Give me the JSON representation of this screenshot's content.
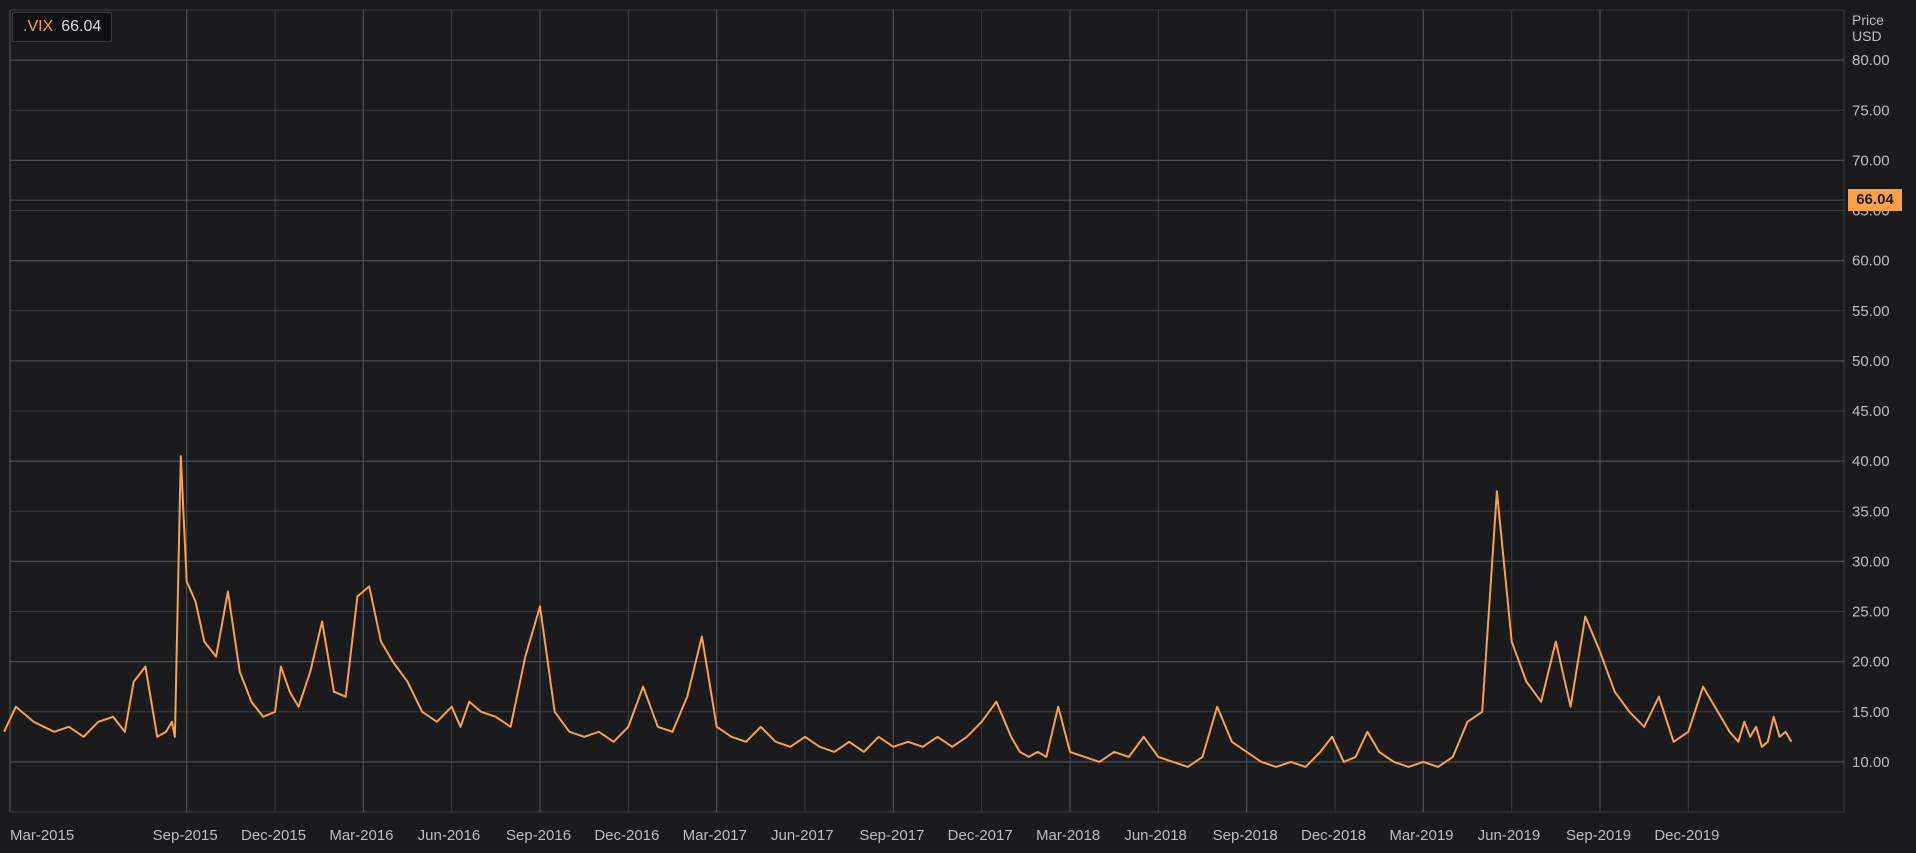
{
  "legend": {
    "ticker": ".VIX",
    "value": "66.04"
  },
  "axis_title": {
    "line1": "Price",
    "line2": "USD"
  },
  "last_price_badge": "66.04",
  "colors": {
    "series": "#f7a14a",
    "background": "#1b1b1d",
    "grid": "#3a3b3f"
  },
  "chart_data": {
    "type": "line",
    "title": "",
    "ylabel": "Price USD",
    "ylim": [
      5,
      85
    ],
    "y_ticks": [
      "10.00",
      "15.00",
      "20.00",
      "25.00",
      "30.00",
      "35.00",
      "40.00",
      "45.00",
      "50.00",
      "55.00",
      "60.00",
      "65.00",
      "70.00",
      "75.00",
      "80.00"
    ],
    "x_tick_labels": [
      "Mar-2015",
      "Sep-2015",
      "Dec-2015",
      "Mar-2016",
      "Jun-2016",
      "Sep-2016",
      "Dec-2016",
      "Mar-2017",
      "Jun-2017",
      "Sep-2017",
      "Dec-2017",
      "Mar-2018",
      "Jun-2018",
      "Sep-2018",
      "Dec-2018",
      "Mar-2019",
      "Jun-2019",
      "Sep-2019",
      "Dec-2019"
    ],
    "grid": true,
    "series": [
      {
        "name": ".VIX",
        "x_months_from_2015_03": [
          -0.2,
          0.2,
          0.8,
          1.5,
          2.0,
          2.5,
          3.0,
          3.5,
          3.9,
          4.2,
          4.6,
          5.0,
          5.3,
          5.5,
          5.6,
          5.8,
          6.0,
          6.3,
          6.6,
          7.0,
          7.4,
          7.8,
          8.2,
          8.6,
          9.0,
          9.2,
          9.5,
          9.8,
          10.2,
          10.6,
          11.0,
          11.4,
          11.8,
          12.2,
          12.6,
          13.0,
          13.5,
          14.0,
          14.5,
          15.0,
          15.3,
          15.6,
          16.0,
          16.5,
          17.0,
          17.5,
          18.0,
          18.5,
          19.0,
          19.5,
          20.0,
          20.5,
          21.0,
          21.5,
          22.0,
          22.5,
          23.0,
          23.5,
          24.0,
          24.5,
          25.0,
          25.5,
          26.0,
          26.5,
          27.0,
          27.5,
          28.0,
          28.5,
          29.0,
          29.5,
          30.0,
          30.5,
          31.0,
          31.5,
          32.0,
          32.5,
          33.0,
          33.5,
          34.0,
          34.3,
          34.6,
          34.9,
          35.2,
          35.6,
          36.0,
          36.5,
          37.0,
          37.5,
          38.0,
          38.5,
          39.0,
          39.5,
          40.0,
          40.5,
          41.0,
          41.5,
          42.0,
          42.5,
          43.0,
          43.5,
          44.0,
          44.5,
          44.9,
          45.3,
          45.7,
          46.1,
          46.5,
          47.0,
          47.5,
          48.0,
          48.5,
          49.0,
          49.5,
          50.0,
          50.5,
          51.0,
          51.5,
          52.0,
          52.5,
          53.0,
          53.5,
          54.0,
          54.5,
          55.0,
          55.5,
          56.0,
          56.5,
          57.0,
          57.5,
          58.0,
          58.4,
          58.7,
          58.9,
          59.1,
          59.3,
          59.5,
          59.7,
          59.9,
          60.1,
          60.3,
          60.5,
          60.7,
          60.9,
          61.1,
          61.3
        ],
        "y": [
          13.0,
          15.5,
          14.0,
          13.0,
          13.5,
          12.5,
          14.0,
          14.5,
          13.0,
          18.0,
          19.5,
          12.5,
          13.0,
          14.0,
          12.5,
          40.5,
          28.0,
          26.0,
          22.0,
          20.5,
          27.0,
          19.0,
          16.0,
          14.5,
          15.0,
          19.5,
          17.0,
          15.5,
          19.0,
          24.0,
          17.0,
          16.5,
          26.5,
          27.5,
          22.0,
          20.0,
          18.0,
          15.0,
          14.0,
          15.5,
          13.5,
          16.0,
          15.0,
          14.5,
          13.5,
          20.5,
          25.5,
          15.0,
          13.0,
          12.5,
          13.0,
          12.0,
          13.5,
          17.5,
          13.5,
          13.0,
          16.5,
          22.5,
          13.5,
          12.5,
          12.0,
          13.5,
          12.0,
          11.5,
          12.5,
          11.5,
          11.0,
          12.0,
          11.0,
          12.5,
          11.5,
          12.0,
          11.5,
          12.5,
          11.5,
          12.5,
          14.0,
          16.0,
          12.5,
          11.0,
          10.5,
          11.0,
          10.5,
          15.5,
          11.0,
          10.5,
          10.0,
          11.0,
          10.5,
          12.5,
          10.5,
          10.0,
          9.5,
          10.5,
          15.5,
          12.0,
          11.0,
          10.0,
          9.5,
          10.0,
          9.5,
          11.0,
          12.5,
          10.0,
          10.5,
          13.0,
          11.0,
          10.0,
          9.5,
          10.0,
          9.5,
          10.5,
          14.0,
          15.0,
          37.0,
          22.0,
          18.0,
          16.0,
          22.0,
          15.5,
          24.5,
          21.0,
          17.0,
          15.0,
          13.5,
          16.5,
          12.0,
          13.0,
          17.5,
          15.0,
          13.0,
          12.0,
          14.0,
          12.5,
          13.5,
          11.5,
          12.0,
          14.5,
          12.5,
          13.0,
          12.0
        ]
      }
    ]
  }
}
